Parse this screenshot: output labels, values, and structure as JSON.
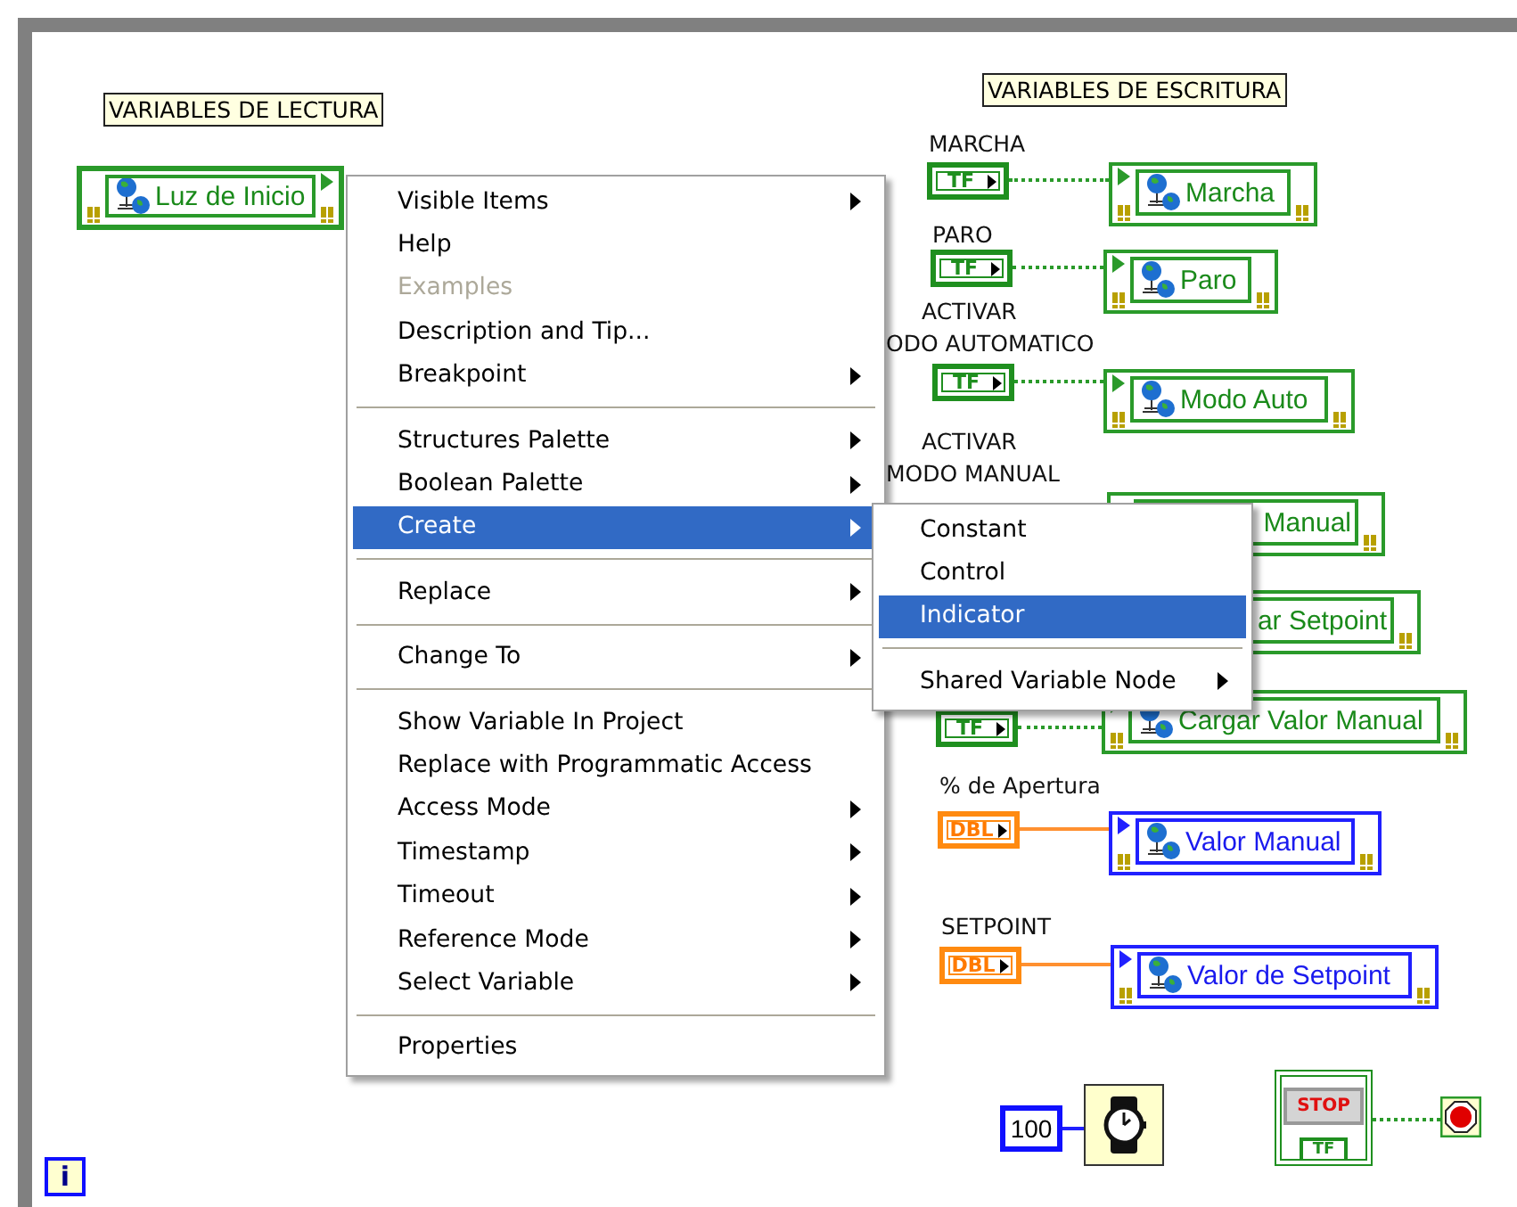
{
  "loop": {
    "iteration": "i"
  },
  "read_section": {
    "title": "VARIABLES DE LECTURA",
    "variables": [
      {
        "name": "Luz de Inicio",
        "kind": "boolean"
      }
    ]
  },
  "write_section": {
    "title": "VARIABLES DE ESCRITURA",
    "variables": [
      {
        "label_lines": [
          "MARCHA"
        ],
        "terminal": "TF",
        "kind": "boolean",
        "name": "Marcha"
      },
      {
        "label_lines": [
          "PARO"
        ],
        "terminal": "TF",
        "kind": "boolean",
        "name": "Paro"
      },
      {
        "label_lines": [
          "ACTIVAR",
          "ODO AUTOMATICO"
        ],
        "terminal": "TF",
        "kind": "boolean",
        "name": "Modo Auto"
      },
      {
        "label_lines": [
          "ACTIVAR",
          "MODO MANUAL"
        ],
        "kind": "boolean",
        "name": "Manual"
      },
      {
        "kind": "boolean",
        "name": "ar Setpoint"
      },
      {
        "terminal": "TF",
        "kind": "boolean",
        "name": "Cargar Valor Manual"
      },
      {
        "label_lines": [
          "% de Apertura"
        ],
        "terminal": "DBL",
        "kind": "double",
        "name": "Valor Manual"
      },
      {
        "label_lines": [
          "SETPOINT"
        ],
        "terminal": "DBL",
        "kind": "double",
        "name": "Valor de Setpoint"
      }
    ]
  },
  "wait": {
    "constant": "100"
  },
  "stop": {
    "button": "STOP",
    "terminal": "TF"
  },
  "context_menu": {
    "items": [
      {
        "kind": "item",
        "label": "Visible Items",
        "submenu": true,
        "disabled": false,
        "selected": false
      },
      {
        "kind": "item",
        "label": "Help",
        "submenu": false,
        "disabled": false,
        "selected": false
      },
      {
        "kind": "item",
        "label": "Examples",
        "submenu": false,
        "disabled": true,
        "selected": false
      },
      {
        "kind": "item",
        "label": "Description and Tip...",
        "submenu": false,
        "disabled": false,
        "selected": false
      },
      {
        "kind": "item",
        "label": "Breakpoint",
        "submenu": true,
        "disabled": false,
        "selected": false
      },
      {
        "kind": "separator"
      },
      {
        "kind": "item",
        "label": "Structures Palette",
        "submenu": true,
        "disabled": false,
        "selected": false
      },
      {
        "kind": "item",
        "label": "Boolean Palette",
        "submenu": true,
        "disabled": false,
        "selected": false
      },
      {
        "kind": "item",
        "label": "Create",
        "submenu": true,
        "disabled": false,
        "selected": true
      },
      {
        "kind": "separator"
      },
      {
        "kind": "item",
        "label": "Replace",
        "submenu": true,
        "disabled": false,
        "selected": false
      },
      {
        "kind": "separator"
      },
      {
        "kind": "item",
        "label": "Change To",
        "submenu": true,
        "disabled": false,
        "selected": false
      },
      {
        "kind": "separator"
      },
      {
        "kind": "item",
        "label": "Show Variable In Project",
        "submenu": false,
        "disabled": false,
        "selected": false
      },
      {
        "kind": "item",
        "label": "Replace with Programmatic Access",
        "submenu": false,
        "disabled": false,
        "selected": false
      },
      {
        "kind": "item",
        "label": "Access Mode",
        "submenu": true,
        "disabled": false,
        "selected": false
      },
      {
        "kind": "item",
        "label": "Timestamp",
        "submenu": true,
        "disabled": false,
        "selected": false
      },
      {
        "kind": "item",
        "label": "Timeout",
        "submenu": true,
        "disabled": false,
        "selected": false
      },
      {
        "kind": "item",
        "label": "Reference Mode",
        "submenu": true,
        "disabled": false,
        "selected": false
      },
      {
        "kind": "item",
        "label": "Select Variable",
        "submenu": true,
        "disabled": false,
        "selected": false
      },
      {
        "kind": "separator"
      },
      {
        "kind": "item",
        "label": "Properties",
        "submenu": false,
        "disabled": false,
        "selected": false
      }
    ]
  },
  "submenu": {
    "items": [
      {
        "kind": "item",
        "label": "Constant",
        "submenu": false,
        "disabled": false,
        "selected": false
      },
      {
        "kind": "item",
        "label": "Control",
        "submenu": false,
        "disabled": false,
        "selected": false
      },
      {
        "kind": "item",
        "label": "Indicator",
        "submenu": false,
        "disabled": false,
        "selected": true
      },
      {
        "kind": "separator"
      },
      {
        "kind": "item",
        "label": "Shared Variable Node",
        "submenu": true,
        "disabled": false,
        "selected": false
      }
    ]
  }
}
